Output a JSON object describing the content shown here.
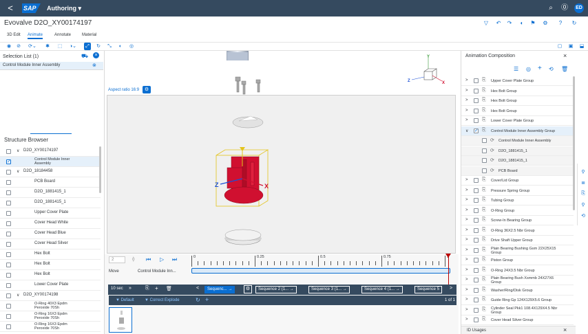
{
  "shell": {
    "back": "<",
    "logo": "SAP",
    "title": "Authoring ▾",
    "icons": [
      "search-icon",
      "help-icon"
    ],
    "avatar": "ED"
  },
  "header": {
    "title": "Evovalve D2O_XY00174197",
    "tabs": [
      "3D Edit",
      "Animate",
      "Annotate",
      "Material"
    ],
    "selected_tab": "Animate"
  },
  "selection": {
    "title": "Selection List (1)",
    "item": "Control Module Inner Assembly"
  },
  "structure": {
    "title": "Structure Browser",
    "rows": [
      {
        "label": "D2O_XY00174197",
        "indent": 0,
        "caret": "∨",
        "checked": false
      },
      {
        "label": "Control Module Inner Assembly",
        "indent": 1,
        "caret": "",
        "checked": true,
        "selected": true
      },
      {
        "label": "D2O_18184458",
        "indent": 0,
        "caret": "∨",
        "checked": false
      },
      {
        "label": "PCB Board",
        "indent": 1,
        "caret": "",
        "checked": false
      },
      {
        "label": "D2O_1881415_1",
        "indent": 1,
        "caret": "",
        "checked": false
      },
      {
        "label": "D2O_1881415_1",
        "indent": 1,
        "caret": "",
        "checked": false
      },
      {
        "label": "Upper Cover Plate",
        "indent": 1,
        "caret": "",
        "checked": false
      },
      {
        "label": "Cover Head White",
        "indent": 1,
        "caret": "",
        "checked": false
      },
      {
        "label": "Cover Head Blue",
        "indent": 1,
        "caret": "",
        "checked": false
      },
      {
        "label": "Cover Head Silver",
        "indent": 1,
        "caret": "",
        "checked": false
      },
      {
        "label": "Hex Bolt",
        "indent": 1,
        "caret": "",
        "checked": false
      },
      {
        "label": "Hex Bolt",
        "indent": 1,
        "caret": "",
        "checked": false
      },
      {
        "label": "Hex Bolt",
        "indent": 1,
        "caret": "",
        "checked": false
      },
      {
        "label": "Lower Cover Plate",
        "indent": 1,
        "caret": "",
        "checked": false
      },
      {
        "label": "D2O_XY00174198",
        "indent": 0,
        "caret": "∨",
        "checked": false
      },
      {
        "label": "O-Ring 40X3 Epdm Peroxide 70Sh",
        "indent": 1,
        "caret": "",
        "checked": false
      },
      {
        "label": "O-Ring 16X3 Epdm Peroxide 70Sh",
        "indent": 1,
        "caret": "",
        "checked": false
      },
      {
        "label": "O-Ring 16X3 Epdm Peroxide 70Sh",
        "indent": 1,
        "caret": "",
        "checked": false
      }
    ]
  },
  "viewport": {
    "aspect": "Aspect ratio 16:9",
    "axes": {
      "x": "X",
      "y": "Y",
      "z": "Z"
    }
  },
  "timeline": {
    "frame": "2",
    "ticks": [
      "0",
      "0.25",
      "0.5",
      "0.75",
      "1"
    ],
    "row_label": "Move",
    "row_item": "Control Module Inn...",
    "duration": "10 sec",
    "sequences": [
      "Sequenc...",
      "Sequence 2 (1...",
      "Sequence 3 (1...",
      "Sequence 4 (1...",
      "Sequence 5"
    ],
    "default": "Default",
    "explode": "Correct Explode",
    "page": "1 of 1",
    "progress": 0.98
  },
  "animation": {
    "title": "Animation Composition",
    "rows": [
      {
        "label": "Upper Cover Plate Group",
        "caret": ">",
        "child": false,
        "checked": false
      },
      {
        "label": "Hex Bolt Group",
        "caret": ">",
        "child": false,
        "checked": false
      },
      {
        "label": "Hex Bolt Group",
        "caret": ">",
        "child": false,
        "checked": false
      },
      {
        "label": "Hex Bolt Group",
        "caret": ">",
        "child": false,
        "checked": false
      },
      {
        "label": "Lower Cover Plate Group",
        "caret": ">",
        "child": false,
        "checked": false
      },
      {
        "label": "Control Module Inner Assembly Group",
        "caret": "∨",
        "child": false,
        "checked": true,
        "hl": true
      },
      {
        "label": "Control Module Inner Assembly",
        "caret": "",
        "child": true,
        "checked": false
      },
      {
        "label": "D2O_1881415_1",
        "caret": "",
        "child": true,
        "checked": false
      },
      {
        "label": "D2O_1881415_1",
        "caret": "",
        "child": true,
        "checked": false
      },
      {
        "label": "PCB Board",
        "caret": "",
        "child": true,
        "checked": false
      },
      {
        "label": "Cover/Lid Group",
        "caret": ">",
        "child": false,
        "checked": false
      },
      {
        "label": "Pressure Spring Group",
        "caret": ">",
        "child": false,
        "checked": false
      },
      {
        "label": "Tubing Group",
        "caret": ">",
        "child": false,
        "checked": false
      },
      {
        "label": "O-Ring Group",
        "caret": ">",
        "child": false,
        "checked": false
      },
      {
        "label": "Screw-In Bearing Group",
        "caret": ">",
        "child": false,
        "checked": false
      },
      {
        "label": "O-Ring 36X2.5 Nbr Group",
        "caret": ">",
        "child": false,
        "checked": false
      },
      {
        "label": "Drive Shaft Upper Group",
        "caret": ">",
        "child": false,
        "checked": false
      },
      {
        "label": "Plain Bearing Bushing Gsm 22X25X15 Group",
        "caret": ">",
        "child": false,
        "checked": false
      },
      {
        "label": "Piston Group",
        "caret": ">",
        "child": false,
        "checked": false
      },
      {
        "label": "O-Ring 24X3.5 Nbr Group",
        "caret": ">",
        "child": false,
        "checked": false
      },
      {
        "label": "Plain Bearing Bush Xsmmb 24X27X6 Group",
        "caret": ">",
        "child": false,
        "checked": false
      },
      {
        "label": "Washer/Ring/Disk Group",
        "caret": ">",
        "child": false,
        "checked": false
      },
      {
        "label": "Guide Ring Gp 124X129X5.6 Group",
        "caret": ">",
        "child": false,
        "checked": false
      },
      {
        "label": "Cylinder Seal Pkk1 108.4X129X4.5 Nbr Group",
        "caret": ">",
        "child": false,
        "checked": false
      },
      {
        "label": "Cover Head Silver Group",
        "caret": ">",
        "child": false,
        "checked": false
      }
    ],
    "footer": "ID Usages"
  }
}
